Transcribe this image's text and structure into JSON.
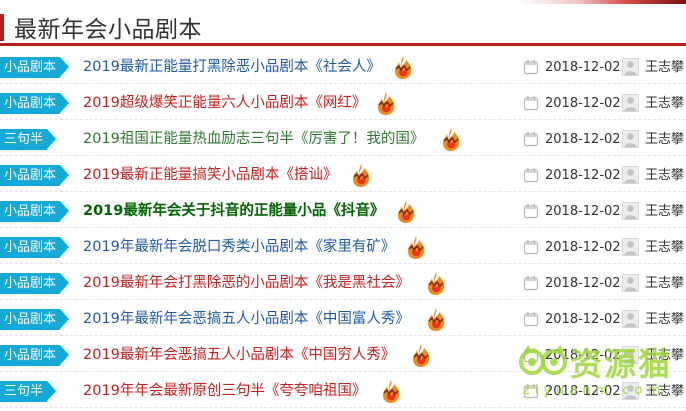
{
  "header": {
    "title": "最新年会小品剧本"
  },
  "colors": {
    "accent": "#b71f1f",
    "tag_bg": "#14a9d7",
    "title_blue": "#1f5ba8",
    "title_red": "#c8201e",
    "title_green": "#2e7a2e",
    "title_bold_green": "#006400",
    "watermark": "#9dd83a"
  },
  "articles": [
    {
      "tag": "小品剧本",
      "title": "2019最新正能量打黑除恶小品剧本《社会人》",
      "color": "blue",
      "bold": false,
      "date": "2018-12-02",
      "author": "王志攀"
    },
    {
      "tag": "小品剧本",
      "title": "2019超级爆笑正能量六人小品剧本《网红》",
      "color": "red",
      "bold": false,
      "date": "2018-12-02",
      "author": "王志攀"
    },
    {
      "tag": "三句半",
      "title": "2019祖国正能量热血励志三句半《厉害了！我的国》",
      "color": "green",
      "bold": false,
      "date": "2018-12-02",
      "author": "王志攀"
    },
    {
      "tag": "小品剧本",
      "title": "2019最新正能量搞笑小品剧本《搭讪》",
      "color": "red",
      "bold": false,
      "date": "2018-12-02",
      "author": "王志攀"
    },
    {
      "tag": "小品剧本",
      "title": "2019最新年会关于抖音的正能量小品《抖音》",
      "color": "boldgreen",
      "bold": true,
      "date": "2018-12-02",
      "author": "王志攀"
    },
    {
      "tag": "小品剧本",
      "title": "2019年最新年会脱口秀类小品剧本《家里有矿》",
      "color": "blue",
      "bold": false,
      "date": "2018-12-02",
      "author": "王志攀"
    },
    {
      "tag": "小品剧本",
      "title": "2019最新年会打黑除恶的小品剧本《我是黑社会》",
      "color": "red",
      "bold": false,
      "date": "2018-12-02",
      "author": "王志攀"
    },
    {
      "tag": "小品剧本",
      "title": "2019年最新年会恶搞五人小品剧本《中国富人秀》",
      "color": "blue",
      "bold": false,
      "date": "2018-12-02",
      "author": "王志攀"
    },
    {
      "tag": "小品剧本",
      "title": "2019最新年会恶搞五人小品剧本《中国穷人秀》",
      "color": "red",
      "bold": false,
      "date": "2018-12-02",
      "author": "王志攀"
    },
    {
      "tag": "三句半",
      "title": "2019年年会最新原创三句半《夸夸咱祖国》",
      "color": "red",
      "bold": false,
      "date": "2018-12-02",
      "author": "王志攀"
    }
  ],
  "watermark": {
    "text": "资源猫",
    "url": "ziyuanm.com"
  }
}
